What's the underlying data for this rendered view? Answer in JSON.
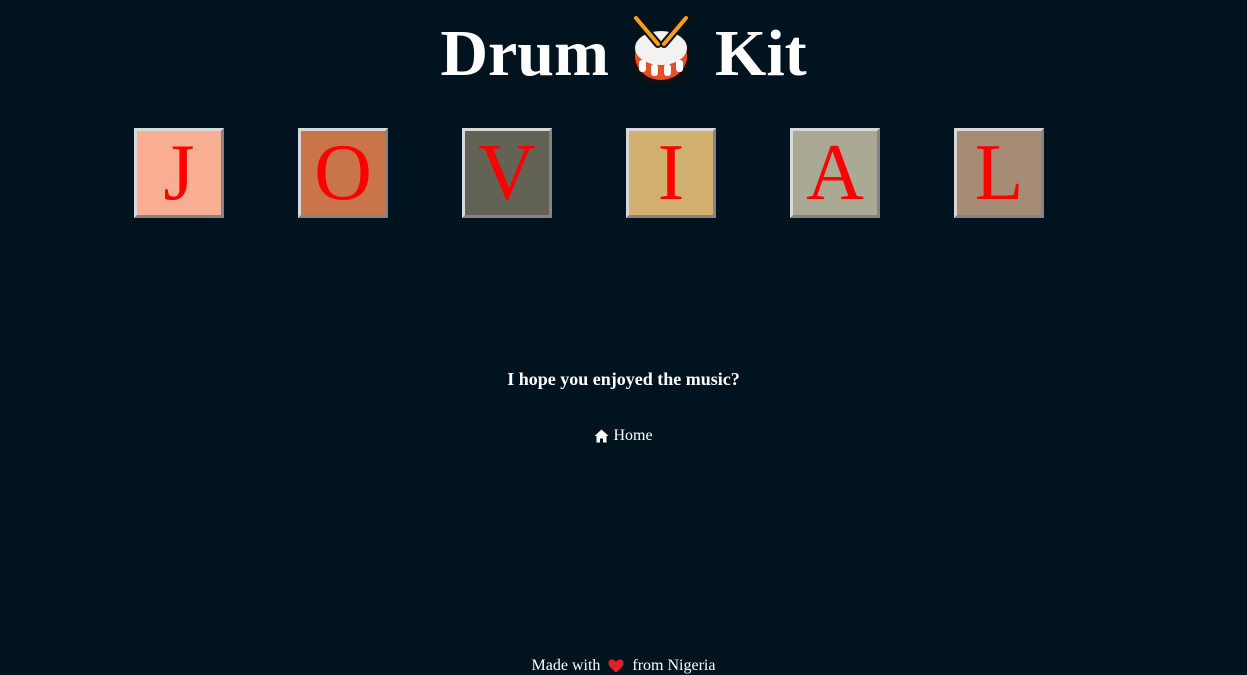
{
  "header": {
    "title_left": "Drum",
    "title_right": "Kit",
    "icon": "drum-icon"
  },
  "pads": [
    {
      "key": "J",
      "color": "#f9ad93"
    },
    {
      "key": "O",
      "color": "#c9744b"
    },
    {
      "key": "V",
      "color": "#626255"
    },
    {
      "key": "I",
      "color": "#d2b070"
    },
    {
      "key": "A",
      "color": "#a9a994"
    },
    {
      "key": "L",
      "color": "#a68c75"
    }
  ],
  "pad_text_color": "#ff0000",
  "main": {
    "message": "I hope you enjoyed the music?"
  },
  "nav": {
    "home_label": "Home",
    "home_icon": "house-icon"
  },
  "footer": {
    "text_before": "Made with",
    "text_after": "from Nigeria",
    "icon": "heart-icon",
    "heart_color": "#e4202c"
  },
  "colors": {
    "background": "#01131e",
    "text": "#ffffff"
  }
}
